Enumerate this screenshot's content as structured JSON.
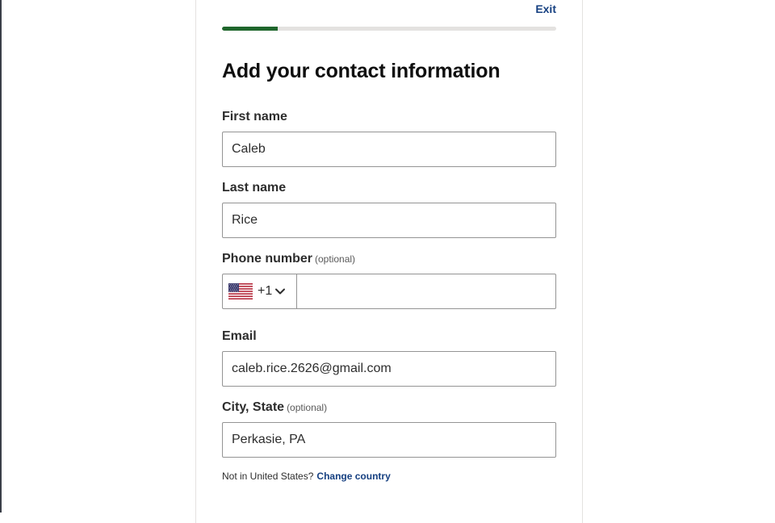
{
  "header": {
    "exit_label": "Exit",
    "progress_fraction": 0.167,
    "progress_color": "#1f662c"
  },
  "page_title": "Add your contact information",
  "form": {
    "first_name": {
      "label": "First name",
      "value": "Caleb"
    },
    "last_name": {
      "label": "Last name",
      "value": "Rice"
    },
    "phone": {
      "label": "Phone number",
      "optional_tag": "(optional)",
      "country_flag_icon": "us-flag-icon",
      "dial_code": "+1",
      "value": ""
    },
    "email": {
      "label": "Email",
      "value": "caleb.rice.2626@gmail.com"
    },
    "city_state": {
      "label": "City, State",
      "optional_tag": "(optional)",
      "value": "Perkasie, PA"
    }
  },
  "country_note": {
    "text": "Not in United States?",
    "link_label": "Change country"
  },
  "colors": {
    "link": "#164081",
    "progress_fill": "#1f662c",
    "progress_track": "#e4e2e0"
  }
}
